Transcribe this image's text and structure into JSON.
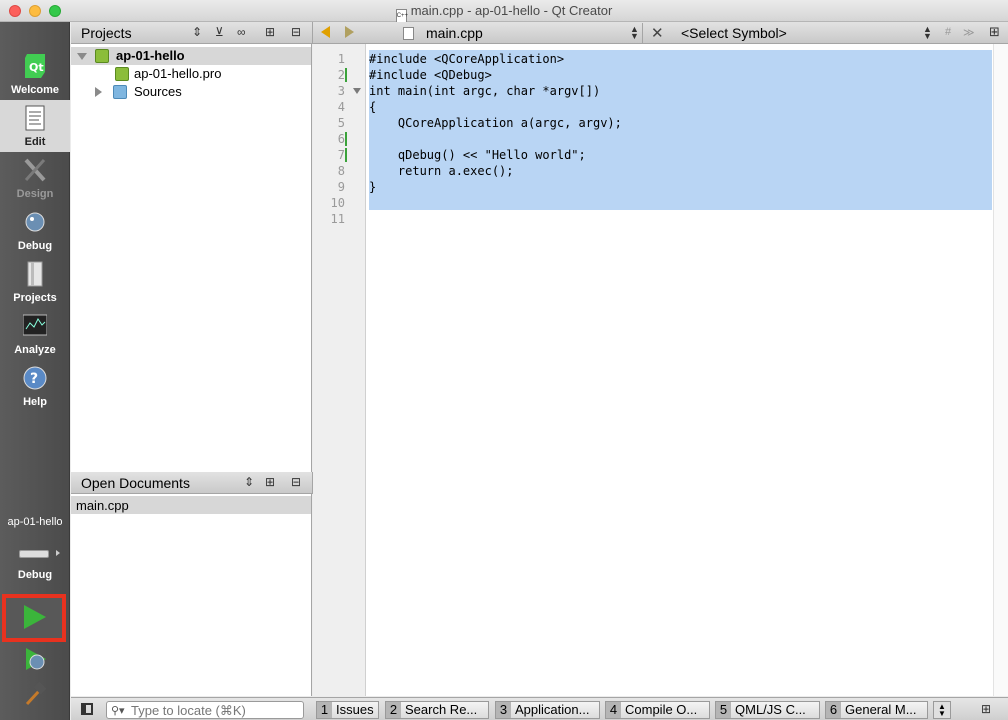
{
  "window": {
    "title": "main.cpp - ap-01-hello - Qt Creator"
  },
  "modes": [
    {
      "label": "Welcome"
    },
    {
      "label": "Edit"
    },
    {
      "label": "Design"
    },
    {
      "label": "Debug"
    },
    {
      "label": "Projects"
    },
    {
      "label": "Analyze"
    },
    {
      "label": "Help"
    }
  ],
  "kit": {
    "project": "ap-01-hello",
    "build_config": "Debug"
  },
  "projects_panel": {
    "title": "Projects",
    "tree": [
      {
        "label": "ap-01-hello",
        "type": "project",
        "expanded": true
      },
      {
        "label": "ap-01-hello.pro",
        "type": "pro-file"
      },
      {
        "label": "Sources",
        "type": "folder",
        "expanded": false
      }
    ]
  },
  "open_documents": {
    "title": "Open Documents",
    "items": [
      "main.cpp"
    ]
  },
  "editor": {
    "current_file": "main.cpp",
    "symbol_placeholder": "<Select Symbol>",
    "line_numbers": [
      "1",
      "2",
      "3",
      "4",
      "5",
      "6",
      "7",
      "8",
      "9",
      "10",
      "11"
    ],
    "lines": [
      "#include <QCoreApplication>",
      "#include <QDebug>",
      "int main(int argc, char *argv[])",
      "{",
      "    QCoreApplication a(argc, argv);",
      "",
      "    qDebug() << \"Hello world\";",
      "    return a.exec();",
      "}",
      "",
      ""
    ]
  },
  "statusbar": {
    "locator_placeholder": "Type to locate (⌘K)",
    "tabs": [
      {
        "num": "1",
        "label": "Issues"
      },
      {
        "num": "2",
        "label": "Search Re..."
      },
      {
        "num": "3",
        "label": "Application..."
      },
      {
        "num": "4",
        "label": "Compile O..."
      },
      {
        "num": "5",
        "label": "QML/JS C..."
      },
      {
        "num": "6",
        "label": "General M..."
      }
    ]
  },
  "colors": {
    "selection": "#b9d5f4",
    "run_highlight": "#e8321f",
    "run_play": "#3bb53b"
  }
}
